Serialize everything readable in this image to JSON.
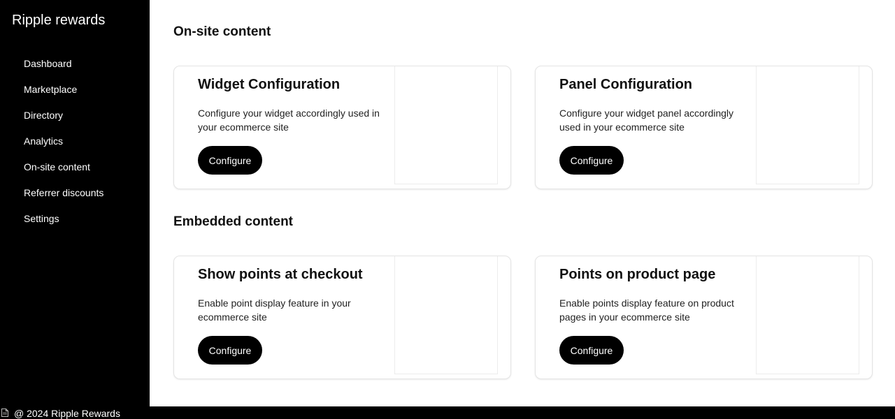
{
  "sidebar": {
    "brand": "Ripple rewards",
    "items": [
      {
        "label": "Dashboard"
      },
      {
        "label": "Marketplace"
      },
      {
        "label": "Directory"
      },
      {
        "label": "Analytics"
      },
      {
        "label": "On-site content"
      },
      {
        "label": "Referrer discounts"
      },
      {
        "label": "Settings"
      }
    ]
  },
  "sections": [
    {
      "title": "On-site content",
      "cards": [
        {
          "title": "Widget Configuration",
          "description": "Configure your widget accordingly used in your ecommerce site",
          "button": "Configure"
        },
        {
          "title": "Panel Configuration",
          "description": "Configure your widget panel accordingly used in your ecommerce site",
          "button": "Configure"
        }
      ]
    },
    {
      "title": "Embedded content",
      "cards": [
        {
          "title": "Show points at checkout",
          "description": "Enable point display feature in your ecommerce site",
          "button": "Configure"
        },
        {
          "title": "Points on product page",
          "description": "Enable points display feature on product pages in your ecommerce site",
          "button": "Configure"
        }
      ]
    }
  ],
  "footer": {
    "text": "@ 2024 Ripple Rewards",
    "icon": "document-icon"
  }
}
